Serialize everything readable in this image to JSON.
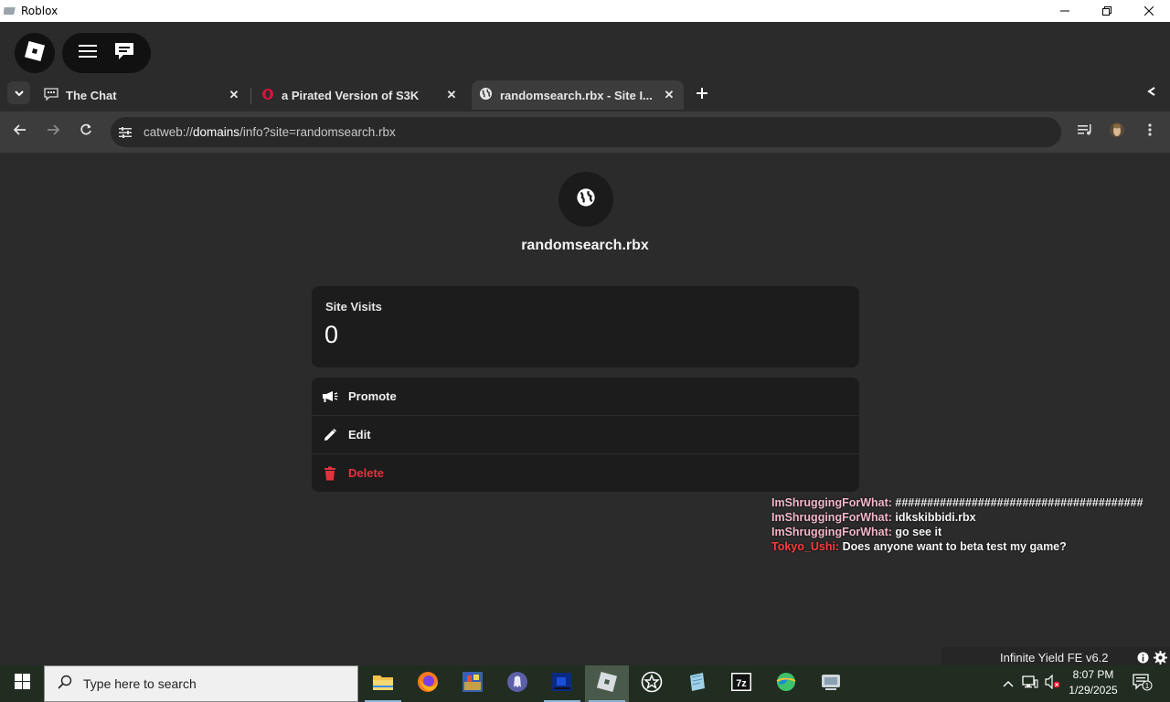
{
  "window": {
    "title": "Roblox",
    "icon": "roblox-icon"
  },
  "tabs": [
    {
      "label": "The Chat",
      "icon": "chat-icon",
      "active": false
    },
    {
      "label": "a Pirated Version of S3K",
      "icon": "opera-like-icon",
      "active": false
    },
    {
      "label": "randomsearch.rbx - Site I...",
      "icon": "globe-icon",
      "active": true
    }
  ],
  "address_bar": {
    "scheme": "catweb://",
    "host": "domains",
    "path": "/info?site=randomsearch.rbx"
  },
  "page": {
    "site_name": "randomsearch.rbx",
    "visits_label": "Site Visits",
    "visits_value": "0",
    "actions": {
      "promote": "Promote",
      "edit": "Edit",
      "delete": "Delete"
    }
  },
  "chat": [
    {
      "user": "ImShruggingForWhat:",
      "message": "#######################################"
    },
    {
      "user": "ImShruggingForWhat:",
      "message": "idkskibbidi.rbx"
    },
    {
      "user": "ImShruggingForWhat:",
      "message": "go see it"
    },
    {
      "user": "Tokyo_Ushi:",
      "message": "Does anyone want to beta test my game?"
    }
  ],
  "infinite_yield": {
    "title": "Infinite Yield FE v6.2"
  },
  "taskbar": {
    "search_placeholder": "Type here to search",
    "time": "8:07 PM",
    "date": "1/29/2025"
  },
  "colors": {
    "background": "#2b2b2b",
    "card": "#1c1c1c",
    "danger": "#e0333d",
    "chat_user": "#f3b7c9",
    "chat_user_alt": "#ff3b3b"
  }
}
